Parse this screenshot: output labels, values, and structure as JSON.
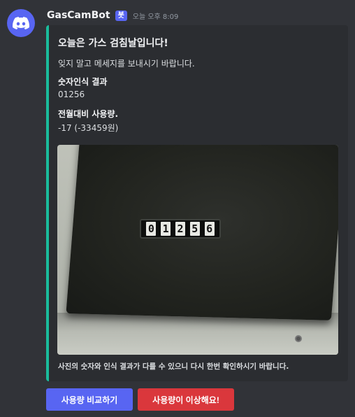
{
  "message": {
    "username": "GasCamBot",
    "bot_tag": "봇",
    "timestamp": "오늘 오후 8:09",
    "avatar_icon": "discord-icon",
    "avatar_color": "#5865f2"
  },
  "embed": {
    "accent_color": "#1abc9c",
    "title": "오늘은 가스 검침날입니다!",
    "description": "잊지 말고 메세지를 보내시기 바랍니다.",
    "fields": [
      {
        "name": "숫자인식 결과",
        "value": "01256"
      },
      {
        "name": "전월대비 사용량.",
        "value": "-17 (-33459원)"
      }
    ],
    "image": {
      "meter_digits": [
        "0",
        "1",
        "2",
        "5",
        "6"
      ]
    },
    "footer": "사진의 숫자와 인식 결과가 다를 수 있으니 다시 한번 확인하시기 바랍니다."
  },
  "buttons": {
    "compare_label": "사용량 비교하기",
    "compare_color": "#5865f2",
    "report_label": "사용량이 이상해요!",
    "report_color": "#da373c"
  }
}
